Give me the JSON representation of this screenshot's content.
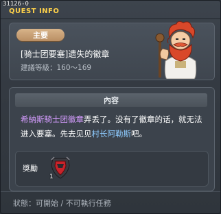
{
  "window": {
    "quest_id": "31126-0",
    "title": "QUEST INFO"
  },
  "header": {
    "badge_label": "主要",
    "quest_name": "[骑士团要塞]遗失的徽章",
    "level_range": "建議等級：160～169"
  },
  "content": {
    "section_label": "內容",
    "text_parts": {
      "p1": "希納斯騎士团徽章",
      "p2": "弄丢了。没有了徽章的话，就无法进入要塞。先去见见",
      "p3": "村长阿勒斯",
      "p4": "吧。"
    }
  },
  "reward": {
    "label": "獎勵",
    "item_icon": "knight-emblem-icon",
    "item_count": "1"
  },
  "footer": {
    "status": "狀態：可開始 / 不可執行任務"
  },
  "colors": {
    "title": "#ffd24a",
    "highlight_purple": "#d59cff",
    "highlight_blue": "#8ecbff",
    "badge": "#c9a174"
  }
}
